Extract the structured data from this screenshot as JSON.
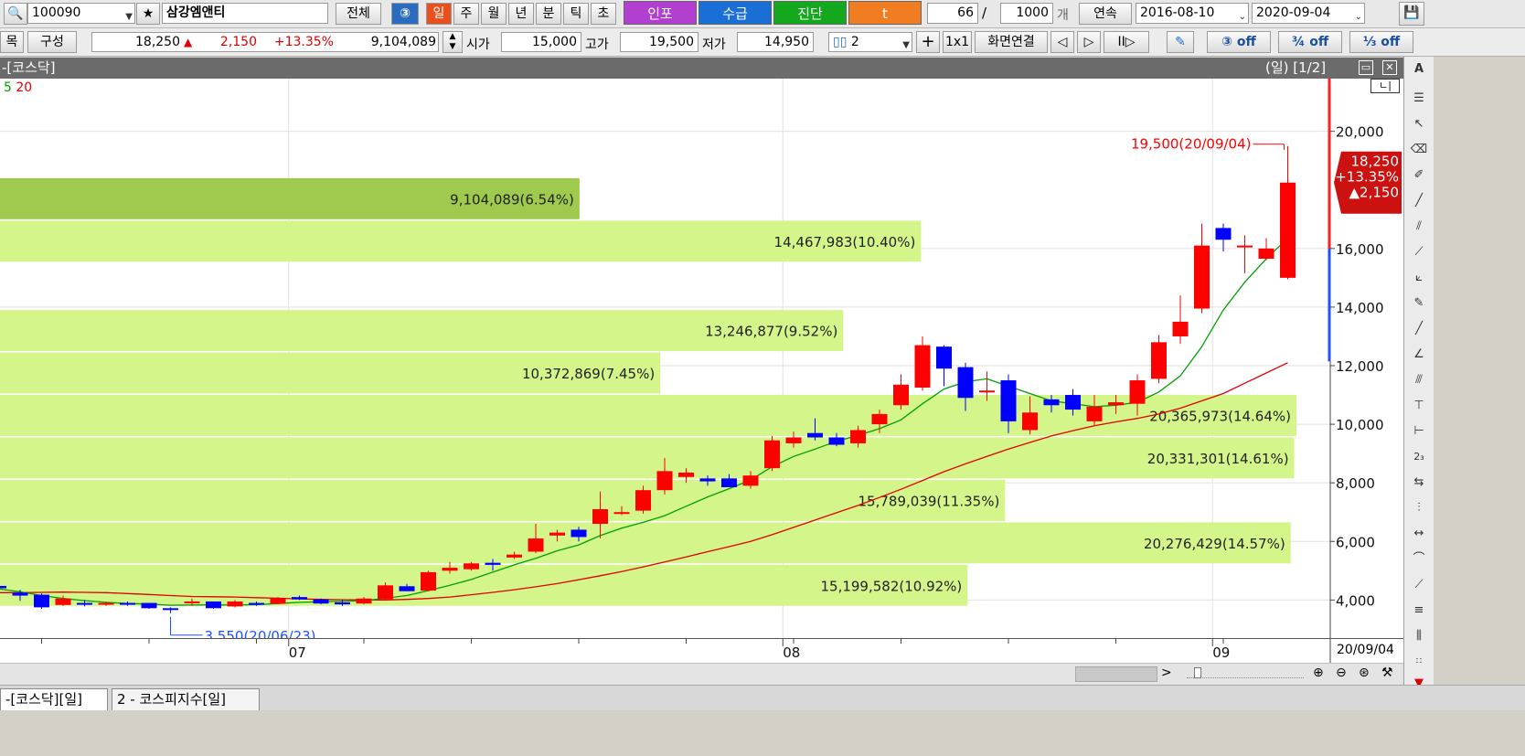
{
  "toolbar1": {
    "code": "100090",
    "name": "삼강엠앤티",
    "all_label": "전체",
    "period_buttons": [
      "일",
      "주",
      "월",
      "년",
      "분",
      "틱",
      "초"
    ],
    "info_label": "인포",
    "supply_label": "수급",
    "diag_label": "진단",
    "t_label": "t",
    "count": "66",
    "slash": "/",
    "total": "1000",
    "unit": "개",
    "continuous_label": "연속",
    "date_from": "2016-08-10",
    "date_to": "2020-09-04"
  },
  "toolbar2": {
    "item_label": "목",
    "compose_label": "구성",
    "price": "18,250",
    "change": "2,150",
    "change_rate": "+13.35%",
    "volume": "9,104,089",
    "open_label": "시가",
    "open": "15,000",
    "high_label": "고가",
    "high": "19,500",
    "low_label": "저가",
    "low": "14,950",
    "split_count": "2",
    "layout_label": "1x1",
    "link_label": "화면연결",
    "off1": "off",
    "off2": "off",
    "off3": "off"
  },
  "chart_title": {
    "left": "-[코스닥]",
    "right": "(일) [1/2]"
  },
  "legend": {
    "ma5": "5",
    "ma20": "20"
  },
  "price_marker": {
    "price": "18,250",
    "rate": "+13.35%",
    "change": "▲2,150"
  },
  "high_annotation": "19,500(20/09/04)",
  "low_annotation": "3,550(20/06/23)",
  "date_label": "20/09/04",
  "bottom_tabs": [
    "-[코스닥][일]",
    "2 - 코스피지수[일]"
  ],
  "chart_data": {
    "type": "candlestick",
    "ylim": [
      2700,
      21800
    ],
    "yticks": [
      4000,
      6000,
      8000,
      10000,
      12000,
      14000,
      16000,
      20000
    ],
    "ytick_labels": [
      "4,000",
      "6,000",
      "8,000",
      "10,000",
      "12,000",
      "14,000",
      "16,000",
      "20,000"
    ],
    "x_labels": [
      {
        "label": "07",
        "index": 13.5
      },
      {
        "label": "08",
        "index": 36.5
      },
      {
        "label": "09",
        "index": 56.5
      }
    ],
    "candles": [
      [
        4480,
        4530,
        4300,
        4400
      ],
      [
        4250,
        4350,
        3970,
        4150
      ],
      [
        4180,
        4220,
        3700,
        3750
      ],
      [
        3830,
        4150,
        3800,
        4050
      ],
      [
        3900,
        4000,
        3780,
        3850
      ],
      [
        3870,
        3950,
        3800,
        3900
      ],
      [
        3900,
        3950,
        3800,
        3850
      ],
      [
        3900,
        3900,
        3700,
        3720
      ],
      [
        3720,
        3750,
        3550,
        3700
      ],
      [
        3900,
        4050,
        3800,
        3950
      ],
      [
        3950,
        3950,
        3700,
        3720
      ],
      [
        3780,
        4000,
        3750,
        3950
      ],
      [
        3900,
        3950,
        3800,
        3850
      ],
      [
        3870,
        4100,
        3850,
        4050
      ],
      [
        4100,
        4150,
        4000,
        4020
      ],
      [
        4020,
        4050,
        3850,
        3880
      ],
      [
        3920,
        4000,
        3800,
        3850
      ],
      [
        3880,
        4100,
        3850,
        4050
      ],
      [
        4030,
        4600,
        4000,
        4500
      ],
      [
        4470,
        4550,
        4300,
        4300
      ],
      [
        4320,
        5000,
        4300,
        4950
      ],
      [
        5000,
        5300,
        4900,
        5100
      ],
      [
        5050,
        5300,
        5000,
        5250
      ],
      [
        5270,
        5400,
        5000,
        5200
      ],
      [
        5450,
        5650,
        5400,
        5550
      ],
      [
        5650,
        6600,
        5600,
        6100
      ],
      [
        6200,
        6400,
        6000,
        6300
      ],
      [
        6400,
        6500,
        6000,
        6150
      ],
      [
        6600,
        7700,
        6100,
        7100
      ],
      [
        7000,
        7200,
        6900,
        7000
      ],
      [
        7050,
        7900,
        6950,
        7750
      ],
      [
        7750,
        8850,
        7600,
        8400
      ],
      [
        8200,
        8500,
        8000,
        8350
      ],
      [
        8150,
        8250,
        7900,
        8050
      ],
      [
        8150,
        8300,
        7850,
        7850
      ],
      [
        7900,
        8400,
        7800,
        8250
      ],
      [
        8500,
        9600,
        8400,
        9450
      ],
      [
        9350,
        9750,
        9200,
        9550
      ],
      [
        9700,
        10200,
        9450,
        9550
      ],
      [
        9550,
        9700,
        9250,
        9300
      ],
      [
        9350,
        9950,
        9200,
        9800
      ],
      [
        10000,
        10500,
        9700,
        10350
      ],
      [
        10650,
        11700,
        10500,
        11350
      ],
      [
        11250,
        13000,
        11150,
        12700
      ],
      [
        12650,
        12700,
        11300,
        11900
      ],
      [
        11950,
        12100,
        10450,
        10900
      ],
      [
        11150,
        11800,
        10800,
        11150
      ],
      [
        11500,
        11700,
        9700,
        10100
      ],
      [
        9800,
        10950,
        9650,
        10400
      ],
      [
        10850,
        11000,
        10400,
        10650
      ],
      [
        11000,
        11200,
        10300,
        10500
      ],
      [
        10100,
        11000,
        9950,
        10600
      ],
      [
        10650,
        11000,
        10350,
        10750
      ],
      [
        10700,
        11700,
        10300,
        11500
      ],
      [
        11550,
        13050,
        11400,
        12800
      ],
      [
        13000,
        14400,
        12750,
        13500
      ],
      [
        13950,
        16850,
        13800,
        16100
      ],
      [
        16700,
        16850,
        15900,
        16300
      ],
      [
        16050,
        16450,
        15150,
        16100
      ],
      [
        15650,
        16350,
        15600,
        16000
      ],
      [
        15000,
        19500,
        14950,
        18250
      ]
    ],
    "ma5": [
      4380,
      4280,
      4150,
      4050,
      3980,
      3920,
      3880,
      3860,
      3820,
      3830,
      3830,
      3830,
      3840,
      3880,
      3920,
      3940,
      3960,
      3970,
      4060,
      4150,
      4320,
      4500,
      4700,
      4950,
      5200,
      5420,
      5680,
      5880,
      6200,
      6450,
      6650,
      6880,
      7200,
      7520,
      7800,
      8100,
      8550,
      8900,
      9150,
      9420,
      9620,
      9850,
      10150,
      10700,
      11200,
      11450,
      11550,
      11300,
      11050,
      10800,
      10700,
      10600,
      10650,
      10750,
      11100,
      11650,
      12650,
      13900,
      14850,
      15650,
      16350
    ],
    "ma20": [
      4250,
      4250,
      4260,
      4270,
      4260,
      4250,
      4220,
      4190,
      4150,
      4120,
      4110,
      4100,
      4080,
      4060,
      4040,
      4020,
      4010,
      4000,
      4000,
      4020,
      4050,
      4100,
      4180,
      4260,
      4350,
      4450,
      4560,
      4690,
      4830,
      4970,
      5130,
      5300,
      5470,
      5650,
      5820,
      6000,
      6230,
      6480,
      6730,
      6980,
      7230,
      7500,
      7780,
      8080,
      8380,
      8650,
      8900,
      9150,
      9380,
      9600,
      9780,
      9950,
      10080,
      10200,
      10350,
      10550,
      10800,
      11050,
      11400,
      11750,
      12100
    ],
    "volume_profile": [
      {
        "price_lo": 17000,
        "price_hi": 18400,
        "volume": "9,104,089",
        "pct": "6.54%"
      },
      {
        "price_lo": 15550,
        "price_hi": 16950,
        "volume": "14,467,983",
        "pct": "10.40%"
      },
      {
        "price_lo": 12500,
        "price_hi": 13900,
        "volume": "13,246,877",
        "pct": "9.52%"
      },
      {
        "price_lo": 11050,
        "price_hi": 12450,
        "volume": "10,372,869",
        "pct": "7.45%"
      },
      {
        "price_lo": 9600,
        "price_hi": 11000,
        "volume": "20,365,973",
        "pct": "14.64%"
      },
      {
        "price_lo": 8150,
        "price_hi": 9550,
        "volume": "20,331,301",
        "pct": "14.61%"
      },
      {
        "price_lo": 6700,
        "price_hi": 8100,
        "volume": "15,789,039",
        "pct": "11.35%"
      },
      {
        "price_lo": 5250,
        "price_hi": 6650,
        "volume": "20,276,429",
        "pct": "14.57%"
      },
      {
        "price_lo": 3800,
        "price_hi": 5200,
        "volume": "15,199,582",
        "pct": "10.92%"
      }
    ]
  },
  "colors": {
    "up": "#ff0000",
    "down": "#0000ff",
    "ma5": "#00a000",
    "ma20": "#e00000",
    "profile": "#d4f58a",
    "profile_max": "#9fca4e"
  }
}
